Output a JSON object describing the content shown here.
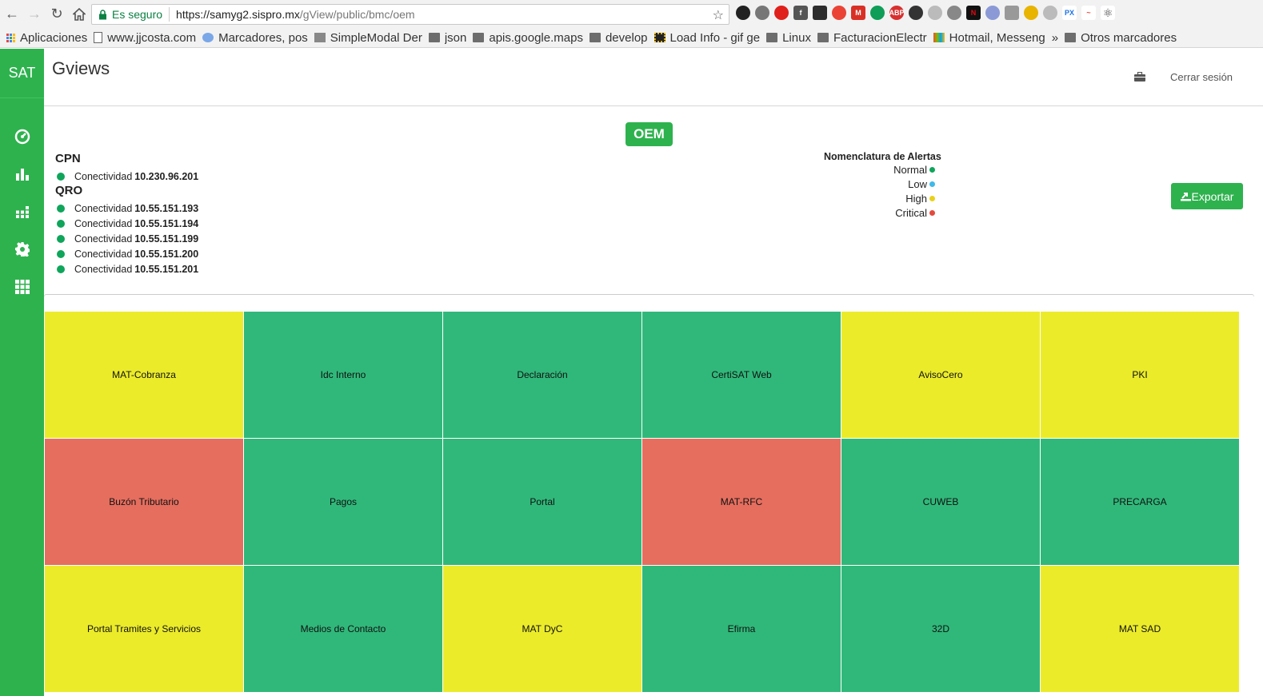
{
  "browser": {
    "secure_label": "Es seguro",
    "url_host": "https://samyg2.sispro.mx",
    "url_path": "/gView/public/bmc/oem",
    "bookmarks": [
      {
        "label": "Aplicaciones",
        "icon": "apps-icon"
      },
      {
        "label": "www.jjcosta.com",
        "icon": "page-icon"
      },
      {
        "label": "Marcadores, pos",
        "icon": "page-icon"
      },
      {
        "label": "SimpleModal Der",
        "icon": "page-icon"
      },
      {
        "label": "json",
        "icon": "folder-icon"
      },
      {
        "label": "apis.google.maps",
        "icon": "folder-icon"
      },
      {
        "label": "develop",
        "icon": "folder-icon"
      },
      {
        "label": "Load Info - gif ge",
        "icon": "page-icon"
      },
      {
        "label": "Linux",
        "icon": "folder-icon"
      },
      {
        "label": "FacturacionElectr",
        "icon": "folder-icon"
      },
      {
        "label": "Hotmail, Messeng",
        "icon": "page-icon"
      },
      {
        "label": "»",
        "icon": ""
      },
      {
        "label": "Otros marcadores",
        "icon": "folder-icon"
      }
    ]
  },
  "app": {
    "brand": "SAT",
    "title": "Gviews",
    "logout": "Cerrar sesión",
    "badge": "OEM",
    "export_label": "Exportar"
  },
  "sites": [
    {
      "name": "CPN",
      "connections": [
        {
          "label": "Conectividad",
          "ip": "10.230.96.201",
          "status": "normal"
        }
      ]
    },
    {
      "name": "QRO",
      "connections": [
        {
          "label": "Conectividad",
          "ip": "10.55.151.193",
          "status": "normal"
        },
        {
          "label": "Conectividad",
          "ip": "10.55.151.194",
          "status": "normal"
        },
        {
          "label": "Conectividad",
          "ip": "10.55.151.199",
          "status": "normal"
        },
        {
          "label": "Conectividad",
          "ip": "10.55.151.200",
          "status": "normal"
        },
        {
          "label": "Conectividad",
          "ip": "10.55.151.201",
          "status": "normal"
        }
      ]
    }
  ],
  "legend": {
    "title": "Nomenclatura de Alertas",
    "items": [
      {
        "label": "Normal",
        "color": "#0fa55b"
      },
      {
        "label": "Low",
        "color": "#3fb9e8"
      },
      {
        "label": "High",
        "color": "#e9d11a"
      },
      {
        "label": "Critical",
        "color": "#e34a3d"
      }
    ]
  },
  "colors": {
    "brand_green": "#2eb24e",
    "tile_normal": "#30b87a",
    "tile_high": "#ebeb2a",
    "tile_critical": "#e56e5f"
  },
  "services": [
    {
      "name": "MAT-Cobranza",
      "status": "high"
    },
    {
      "name": "Idc Interno",
      "status": "normal"
    },
    {
      "name": "Declaración",
      "status": "normal"
    },
    {
      "name": "CertiSAT Web",
      "status": "normal"
    },
    {
      "name": "AvisoCero",
      "status": "high"
    },
    {
      "name": "PKI",
      "status": "high"
    },
    {
      "name": "Buzón Tributario",
      "status": "critical"
    },
    {
      "name": "Pagos",
      "status": "normal"
    },
    {
      "name": "Portal",
      "status": "normal"
    },
    {
      "name": "MAT-RFC",
      "status": "critical"
    },
    {
      "name": "CUWEB",
      "status": "normal"
    },
    {
      "name": "PRECARGA",
      "status": "normal"
    },
    {
      "name": "Portal Tramites y Servicios",
      "status": "high"
    },
    {
      "name": "Medios de Contacto",
      "status": "normal"
    },
    {
      "name": "MAT DyC",
      "status": "high"
    },
    {
      "name": "Efirma",
      "status": "normal"
    },
    {
      "name": "32D",
      "status": "normal"
    },
    {
      "name": "MAT SAD",
      "status": "high"
    }
  ]
}
